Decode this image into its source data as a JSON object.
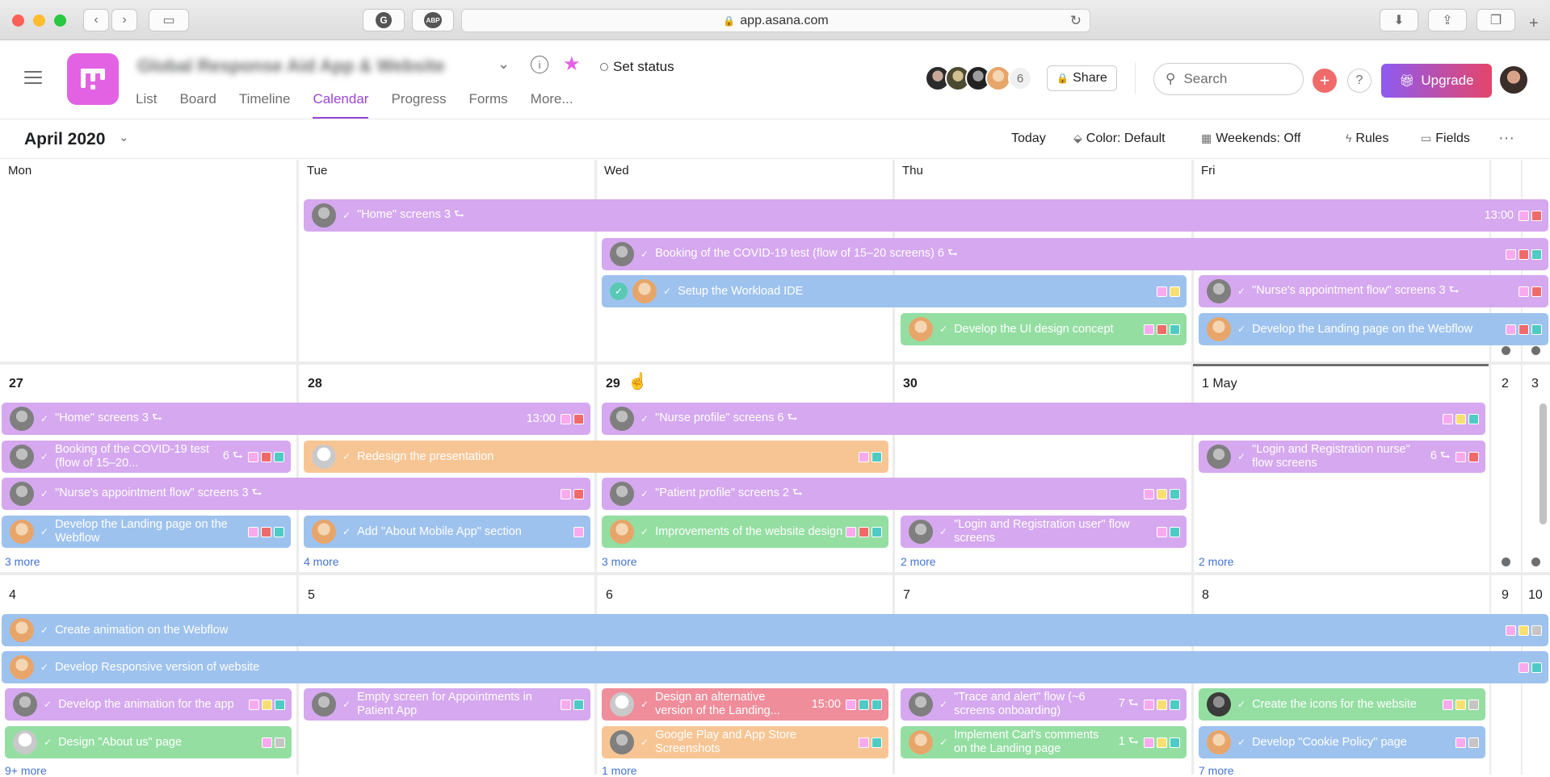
{
  "browser": {
    "url": "app.asana.com",
    "icons": [
      "back-icon",
      "forward-icon",
      "sidebar-icon",
      "grammarly-icon",
      "adblock-icon",
      "reload-icon",
      "download-icon",
      "share-icon",
      "tabs-icon",
      "new-tab-icon"
    ],
    "extensions": [
      "G",
      "ABP"
    ]
  },
  "header": {
    "project_name": "Global Response Aid App & Website",
    "set_status": "Set status",
    "views": [
      "List",
      "Board",
      "Timeline",
      "Calendar",
      "Progress",
      "Forms",
      "More..."
    ],
    "active_view": "Calendar",
    "member_count": "6",
    "share": "Share",
    "search_placeholder": "Search",
    "add": "+",
    "help": "?",
    "upgrade": "Upgrade"
  },
  "toolbar": {
    "month": "April 2020",
    "today": "Today",
    "color": "Color: Default",
    "weekends": "Weekends: Off",
    "rules": "Rules",
    "fields": "Fields",
    "overflow": "···"
  },
  "weekdays": [
    "Mon",
    "Tue",
    "Wed",
    "Thu",
    "Fri"
  ],
  "tag_colors": {
    "pink": "#f9aaef",
    "red": "#f06a6a",
    "yellow": "#f8df72",
    "teal": "#4ecbc4",
    "grey": "#c7c4c4"
  },
  "week1": {
    "tasks": [
      {
        "name": "\"Home\" screens 3 ⮑",
        "time": "13:00"
      },
      {
        "name": "Booking of the COVID-19 test (flow of 15–20 screens) 6 ⮑"
      },
      {
        "name": "Setup the Workload IDE"
      },
      {
        "name": "\"Nurse's appointment flow\" screens 3 ⮑"
      },
      {
        "name": "Develop the UI design concept"
      },
      {
        "name": "Develop the Landing page on the Webflow"
      }
    ]
  },
  "week2": {
    "days": [
      "27",
      "28",
      "29",
      "30",
      "1 May",
      "2",
      "3"
    ],
    "tasks": [
      {
        "name": "\"Home\" screens 3 ⮑",
        "time": "13:00"
      },
      {
        "name": "\"Nurse profile\" screens 6 ⮑"
      },
      {
        "name": "Booking of the COVID-19 test (flow of 15–20...",
        "meta": "6 ⮑"
      },
      {
        "name": "Redesign the presentation"
      },
      {
        "name": "\"Login and Registration nurse\" flow screens",
        "meta": "6 ⮑"
      },
      {
        "name": "\"Nurse's appointment flow\" screens 3 ⮑"
      },
      {
        "name": "\"Patient profile\" screens 2 ⮑"
      },
      {
        "name": "Develop the Landing page on the Webflow"
      },
      {
        "name": "Add \"About Mobile App\" section"
      },
      {
        "name": "Improvements of the website design"
      },
      {
        "name": "\"Login and Registration user\" flow screens"
      }
    ],
    "more": [
      "3 more",
      "4 more",
      "3 more",
      "2 more",
      "2 more"
    ]
  },
  "week3": {
    "days": [
      "4",
      "5",
      "6",
      "7",
      "8",
      "9",
      "10"
    ],
    "tasks": [
      {
        "name": "Create animation on the Webflow"
      },
      {
        "name": "Develop Responsive version of website"
      },
      {
        "name": "Develop the animation for the app"
      },
      {
        "name": "Empty screen for Appointments in Patient App"
      },
      {
        "name": "Design an alternative version of the Landing...",
        "time": "15:00"
      },
      {
        "name": "\"Trace and alert\" flow (~6 screens onboarding)",
        "meta": "7 ⮑"
      },
      {
        "name": "Create the icons for the website"
      },
      {
        "name": "Design \"About us\" page"
      },
      {
        "name": "Google Play and App Store Screenshots"
      },
      {
        "name": "Implement Carl's comments on the Landing page",
        "meta": "1 ⮑"
      },
      {
        "name": "Develop \"Cookie Policy\" page"
      }
    ],
    "more": [
      "9+ more",
      "1 more",
      "7 more"
    ]
  }
}
